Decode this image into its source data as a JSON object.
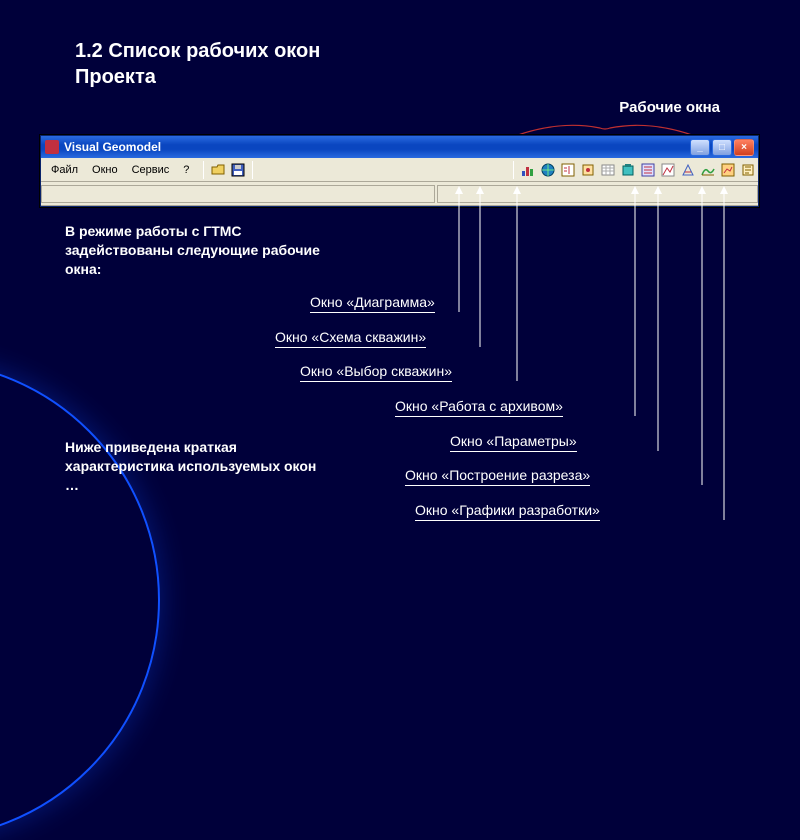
{
  "heading": "1.2 Список рабочих окон Проекта",
  "topright_label": "Рабочие окна",
  "app": {
    "title": "Visual Geomodel",
    "win_min": "_",
    "win_max": "□",
    "win_close": "×",
    "menu": [
      "Файл",
      "Окно",
      "Сервис",
      "?"
    ]
  },
  "desc1": "В режиме работы с ГТМС задействованы следующие рабочие окна:",
  "desc2": "Ниже приведена краткая характеристика используемых окон …",
  "callouts": [
    "Окно «Диаграмма»",
    "Окно «Схема скважин»",
    "Окно «Выбор скважин»",
    "Окно «Работа с архивом»",
    "Окно «Параметры»",
    "Окно «Построение разреза»",
    "Окно «Графики разработки»"
  ]
}
